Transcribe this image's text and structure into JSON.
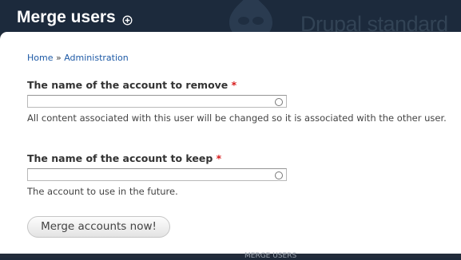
{
  "header": {
    "title": "Merge users",
    "site_name": "Drupal standard",
    "shortcut_icon": "add-shortcut-icon",
    "logo_icon": "drupal-drop-icon"
  },
  "breadcrumb": {
    "items": [
      "Home",
      "Administration"
    ],
    "separator": "»"
  },
  "form": {
    "remove_field": {
      "label": "The name of the account to remove",
      "required_mark": "*",
      "value": "",
      "description": "All content associated with this user will be changed so it is associated with the other user."
    },
    "keep_field": {
      "label": "The name of the account to keep",
      "required_mark": "*",
      "value": "",
      "description": "The account to use in the future."
    },
    "submit_label": "Merge accounts now!"
  },
  "footer": {
    "partial_text": "MERGE USERS"
  },
  "colors": {
    "header_bg": "#1c2a3c",
    "link": "#1e5aa6",
    "required": "#d71b1b"
  }
}
